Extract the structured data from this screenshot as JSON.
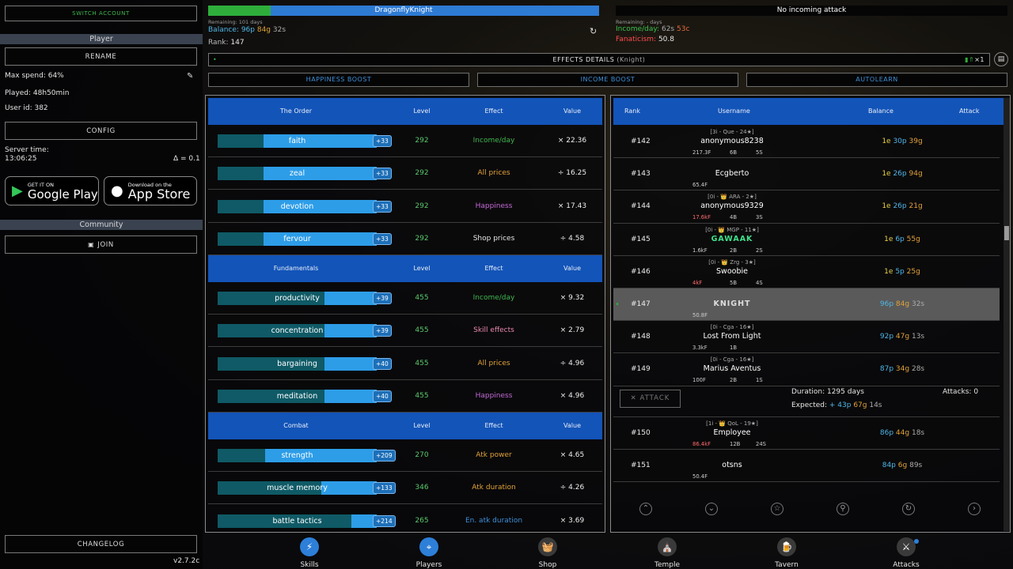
{
  "sidebar": {
    "switch_account": "SWITCH ACCOUNT",
    "player_header": "Player",
    "rename": "RENAME",
    "max_spend": "Max spend: 64%",
    "played": "Played: 48h50min",
    "user_id": "User id: 382",
    "config": "CONFIG",
    "server_time_label": "Server time:",
    "server_time": "13:06:25",
    "delta": "Δ = 0.1",
    "google_small": "GET IT ON",
    "google_big": "Google Play",
    "apple_small": "Download on the",
    "apple_big": "App Store",
    "community_header": "Community",
    "join": "JOIN",
    "changelog": "CHANGELOG",
    "version": "v2.7.2c"
  },
  "top": {
    "player_name": "DragonflyKnight",
    "remaining": "Remaining: 101 days",
    "balance_label": "Balance:",
    "balance_p": "96p",
    "balance_g": "84g",
    "balance_s": "32s",
    "rank_label": "Rank:",
    "rank": "147",
    "attack_status": "No incoming attack",
    "attack_remaining": "Remaining: - days",
    "income_label": "Income/day:",
    "income_s": "62s",
    "income_c": "53c",
    "fanaticism_label": "Fanaticism:",
    "fanaticism": "50.8",
    "effects_label": "EFFECTS DETAILS",
    "effects_sub": "(Knight)",
    "effects_counter": "×1",
    "boost1": "HAPPINESS BOOST",
    "boost2": "INCOME BOOST",
    "boost3": "AUTOLEARN"
  },
  "skills": {
    "cols": {
      "level": "Level",
      "effect": "Effect",
      "value": "Value"
    },
    "categories": [
      {
        "name": "The Order",
        "rows": [
          {
            "name": "faith",
            "badge": "+33",
            "fill": 0.71,
            "level": "292",
            "effect": "Income/day",
            "effect_color": "#3fb84f",
            "value": "× 22.36"
          },
          {
            "name": "zeal",
            "badge": "+33",
            "fill": 0.71,
            "level": "292",
            "effect": "All prices",
            "effect_color": "#e0a23a",
            "value": "÷ 16.25"
          },
          {
            "name": "devotion",
            "badge": "+33",
            "fill": 0.71,
            "level": "292",
            "effect": "Happiness",
            "effect_color": "#c36ad6",
            "value": "× 17.43"
          },
          {
            "name": "fervour",
            "badge": "+33",
            "fill": 0.71,
            "level": "292",
            "effect": "Shop prices",
            "effect_color": "#e6e6e6",
            "value": "÷ 4.58"
          }
        ]
      },
      {
        "name": "Fundamentals",
        "rows": [
          {
            "name": "productivity",
            "badge": "+39",
            "fill": 0.33,
            "level": "455",
            "effect": "Income/day",
            "effect_color": "#3fb84f",
            "value": "× 9.32"
          },
          {
            "name": "concentration",
            "badge": "+39",
            "fill": 0.33,
            "level": "455",
            "effect": "Skill effects",
            "effect_color": "#e98ab0",
            "value": "× 2.79"
          },
          {
            "name": "bargaining",
            "badge": "+40",
            "fill": 0.33,
            "level": "455",
            "effect": "All prices",
            "effect_color": "#e0a23a",
            "value": "÷ 4.96"
          },
          {
            "name": "meditation",
            "badge": "+40",
            "fill": 0.33,
            "level": "455",
            "effect": "Happiness",
            "effect_color": "#c36ad6",
            "value": "× 4.96"
          }
        ]
      },
      {
        "name": "Combat",
        "rows": [
          {
            "name": "strength",
            "badge": "+209",
            "fill": 0.7,
            "level": "270",
            "effect": "Atk power",
            "effect_color": "#e0a23a",
            "value": "× 4.65"
          },
          {
            "name": "muscle memory",
            "badge": "+133",
            "fill": 0.35,
            "level": "346",
            "effect": "Atk duration",
            "effect_color": "#e0a23a",
            "value": "÷ 4.26"
          },
          {
            "name": "battle tactics",
            "badge": "+214",
            "fill": 0.16,
            "level": "265",
            "effect": "En. atk duration",
            "effect_color": "#3f8fd8",
            "value": "× 3.69"
          }
        ]
      }
    ]
  },
  "players": {
    "cols": {
      "rank": "Rank",
      "username": "Username",
      "balance": "Balance",
      "attack": "Attack"
    },
    "rows": [
      {
        "rank": "#142",
        "tag": "[3i - Que - 24★]",
        "name": "anonymous8238",
        "s1": "217.3F",
        "s1c": "#cccccc",
        "s2": "6B",
        "s3": "5S",
        "bal_e": "1e",
        "bal_p": "30p",
        "bal_g": "39g"
      },
      {
        "rank": "#143",
        "tag": "",
        "name": "Ecgberto",
        "s1": "65.4F",
        "s1c": "#cccccc",
        "s2": "",
        "s3": "",
        "bal_e": "1e",
        "bal_p": "26p",
        "bal_g": "94g"
      },
      {
        "rank": "#144",
        "tag": "[0i - 👑 ARA - 2★]",
        "name": "anonymous9329",
        "s1": "17.6kF",
        "s1c": "#ff6b6b",
        "s2": "4B",
        "s3": "3S",
        "bal_e": "1e",
        "bal_p": "26p",
        "bal_g": "21g"
      },
      {
        "rank": "#145",
        "tag": "[0i - 👑 MGP - 11★]",
        "name": "GAWAAK",
        "s1": "1.6kF",
        "s1c": "#cccccc",
        "s2": "2B",
        "s3": "2S",
        "bal_e": "1e",
        "bal_p": "6p",
        "bal_g": "55g"
      },
      {
        "rank": "#146",
        "tag": "[0i - 👑 Zrg - 3★]",
        "name": "Swoobie",
        "s1": "4kF",
        "s1c": "#ff6b6b",
        "s2": "5B",
        "s3": "4S",
        "bal_e": "1e",
        "bal_p": "5p",
        "bal_g": "25g"
      },
      {
        "rank": "#147",
        "tag": "",
        "name": "KNIGHT",
        "s1": "50.8F",
        "s1c": "#cccccc",
        "s2": "",
        "s3": "",
        "bal_e": "",
        "bal_p": "96p",
        "bal_g": "84g",
        "bal_s": "32s",
        "me": true
      },
      {
        "rank": "#148",
        "tag": "[0i - Cga - 16★]",
        "name": "Lost From Light",
        "s1": "3.3kF",
        "s1c": "#cccccc",
        "s2": "1B",
        "s3": "",
        "bal_e": "",
        "bal_p": "92p",
        "bal_g": "47g",
        "bal_s": "13s"
      },
      {
        "rank": "#149",
        "tag": "[0i - Cga - 16★]",
        "name": "Marius Aventus",
        "s1": "100F",
        "s1c": "#cccccc",
        "s2": "2B",
        "s3": "1S",
        "bal_e": "",
        "bal_p": "87p",
        "bal_g": "34g",
        "bal_s": "28s"
      }
    ],
    "attack_button": "ATTACK",
    "duration": "Duration: 1295 days",
    "attacks": "Attacks: 0",
    "expected_label": "Expected:",
    "expected_p": "+ 43p",
    "expected_g": "67g",
    "expected_s": "14s",
    "rows2": [
      {
        "rank": "#150",
        "tag": "[1i - 👑 QoL - 19★]",
        "name": "Employee",
        "s1": "86.4kF",
        "s1c": "#ff6b6b",
        "s2": "12B",
        "s3": "24S",
        "bal_p": "86p",
        "bal_g": "44g",
        "bal_s": "18s"
      },
      {
        "rank": "#151",
        "tag": "",
        "name": "otsns",
        "s1": "50.4F",
        "s1c": "#cccccc",
        "s2": "",
        "s3": "",
        "bal_p": "84p",
        "bal_g": "6g",
        "bal_s": "89s"
      }
    ]
  },
  "nav": [
    {
      "label": "Skills",
      "icon": "lightning-icon",
      "glyph": "⚡",
      "active": true
    },
    {
      "label": "Players",
      "icon": "crosshair-icon",
      "glyph": "⌖",
      "active": true
    },
    {
      "label": "Shop",
      "icon": "basket-icon",
      "glyph": "🧺",
      "active": false
    },
    {
      "label": "Temple",
      "icon": "temple-icon",
      "glyph": "⛪",
      "active": false
    },
    {
      "label": "Tavern",
      "icon": "mug-icon",
      "glyph": "🍺",
      "active": false
    },
    {
      "label": "Attacks",
      "icon": "swords-icon",
      "glyph": "⚔",
      "active": false
    }
  ],
  "colors": {
    "accent": "#1354b8",
    "bar": "#2d9de8",
    "green": "#2fae3c"
  }
}
